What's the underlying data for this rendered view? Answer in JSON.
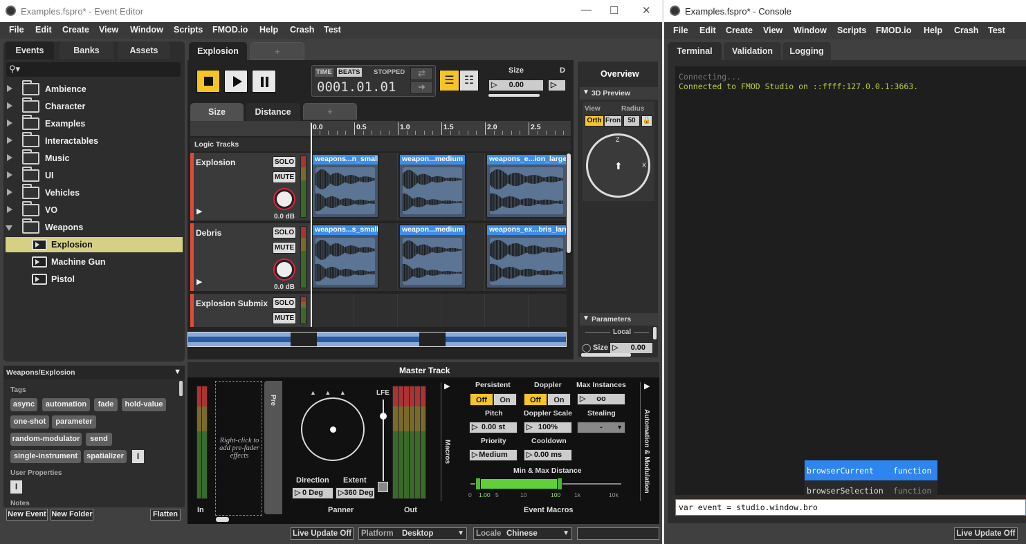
{
  "editor": {
    "title": "Examples.fspro* - Event Editor",
    "menu": [
      "File",
      "Edit",
      "Create",
      "View",
      "Window",
      "Scripts",
      "FMOD.io",
      "Help",
      "Crash",
      "Test"
    ],
    "browser_tabs": [
      "Events",
      "Banks",
      "Assets"
    ],
    "tree": [
      {
        "label": "Ambience",
        "type": "folder"
      },
      {
        "label": "Character",
        "type": "folder"
      },
      {
        "label": "Examples",
        "type": "folder"
      },
      {
        "label": "Interactables",
        "type": "folder"
      },
      {
        "label": "Music",
        "type": "folder"
      },
      {
        "label": "UI",
        "type": "folder"
      },
      {
        "label": "Vehicles",
        "type": "folder"
      },
      {
        "label": "VO",
        "type": "folder"
      },
      {
        "label": "Weapons",
        "type": "folder-open"
      },
      {
        "label": "Explosion",
        "type": "event"
      },
      {
        "label": "Machine Gun",
        "type": "event"
      },
      {
        "label": "Pistol",
        "type": "event"
      }
    ],
    "path": "Weapons/Explosion",
    "tags_heading": "Tags",
    "tags": [
      "async",
      "automation",
      "fade",
      "hold-value",
      "one-shot",
      "parameter",
      "random-modulator",
      "send",
      "single-instrument",
      "spatializer"
    ],
    "user_props_heading": "User Properties",
    "notes_heading": "Notes",
    "bottom_buttons": {
      "new_event": "New Event",
      "new_folder": "New Folder",
      "flatten": "Flatten"
    },
    "event_tab": "Explosion",
    "add_tab": "+",
    "transport": {
      "time": "TIME",
      "beats": "BEATS",
      "state": "STOPPED",
      "position": "0001.01.01"
    },
    "size_param": {
      "label": "Size",
      "value": "0.00",
      "next": "D"
    },
    "param_tabs": [
      "Size",
      "Distance"
    ],
    "ruler": [
      "0.0",
      "0.5",
      "1.0",
      "1.5",
      "2.0",
      "2.5"
    ],
    "logic_tracks": "Logic Tracks",
    "tracks": [
      {
        "name": "Explosion",
        "gain": "0.0 dB",
        "clips": [
          "weapons...n_small",
          "weapon...medium",
          "weapons_e...ion_large"
        ]
      },
      {
        "name": "Debris",
        "gain": "0.0 dB",
        "clips": [
          "weapons...s_small",
          "weapon...medium",
          "weapons_ex...bris_large"
        ]
      },
      {
        "name": "Explosion Submix",
        "gain": "",
        "clips": []
      }
    ],
    "solo": "SOLO",
    "mute": "MUTE",
    "overview": {
      "title": "Overview",
      "preview": "3D Preview",
      "view": "View",
      "radius": "Radius",
      "orth": "Orth",
      "front": "Fron",
      "radius_value": "50",
      "z": "Z",
      "x": "X",
      "parameters": "Parameters",
      "local": "Local",
      "size": "Size",
      "size_value": "0.00"
    },
    "master": {
      "title": "Master Track",
      "in": "In",
      "out": "Out",
      "lfe": "LFE",
      "pre": "Pre",
      "prefader": "Right-click to add pre-fader effects",
      "direction": "Direction",
      "direction_value": "0 Deg",
      "extent": "Extent",
      "extent_value": "360 Deg",
      "panner": "Panner",
      "macros": "Macros",
      "event_macros": "Event Macros",
      "automation": "Automation & Modulation",
      "persistent": "Persistent",
      "doppler": "Doppler",
      "max_instances": "Max Instances",
      "max_instances_value": "oo",
      "off": "Off",
      "on": "On",
      "pitch": "Pitch",
      "pitch_value": "0.00 st",
      "doppler_scale": "Doppler Scale",
      "doppler_scale_value": "100%",
      "stealing": "Stealing",
      "stealing_value": "-",
      "priority": "Priority",
      "priority_value": "Medium",
      "cooldown": "Cooldown",
      "cooldown_value": "0.00 ms",
      "min_max": "Min & Max Distance",
      "scale": [
        "0",
        "1.00",
        "5",
        "10",
        "100",
        "1k",
        "10k"
      ]
    },
    "status": {
      "live": "Live Update Off",
      "platform_label": "Platform",
      "platform": "Desktop",
      "locale_label": "Locale",
      "locale": "Chinese"
    }
  },
  "console": {
    "title": "Examples.fspro* - Console",
    "menu": [
      "File",
      "Edit",
      "Create",
      "View",
      "Window",
      "Scripts",
      "FMOD.io",
      "Help",
      "Crash",
      "Test"
    ],
    "tabs": [
      "Terminal",
      "Validation",
      "Logging"
    ],
    "lines": [
      "Connecting...",
      "Connected to FMOD Studio on ::ffff:127.0.0.1:3663."
    ],
    "autocomplete": [
      {
        "name": "browserCurrent",
        "kind": "function"
      },
      {
        "name": "browserSelection",
        "kind": "function"
      }
    ],
    "input": "var event = studio.window.bro",
    "live": "Live Update Off"
  },
  "colors": {
    "accent": "#f3c528",
    "selection": "#d5d084",
    "clip": "#3e8de8",
    "track": "#e04a3a",
    "console_green": "#b5d13a"
  }
}
